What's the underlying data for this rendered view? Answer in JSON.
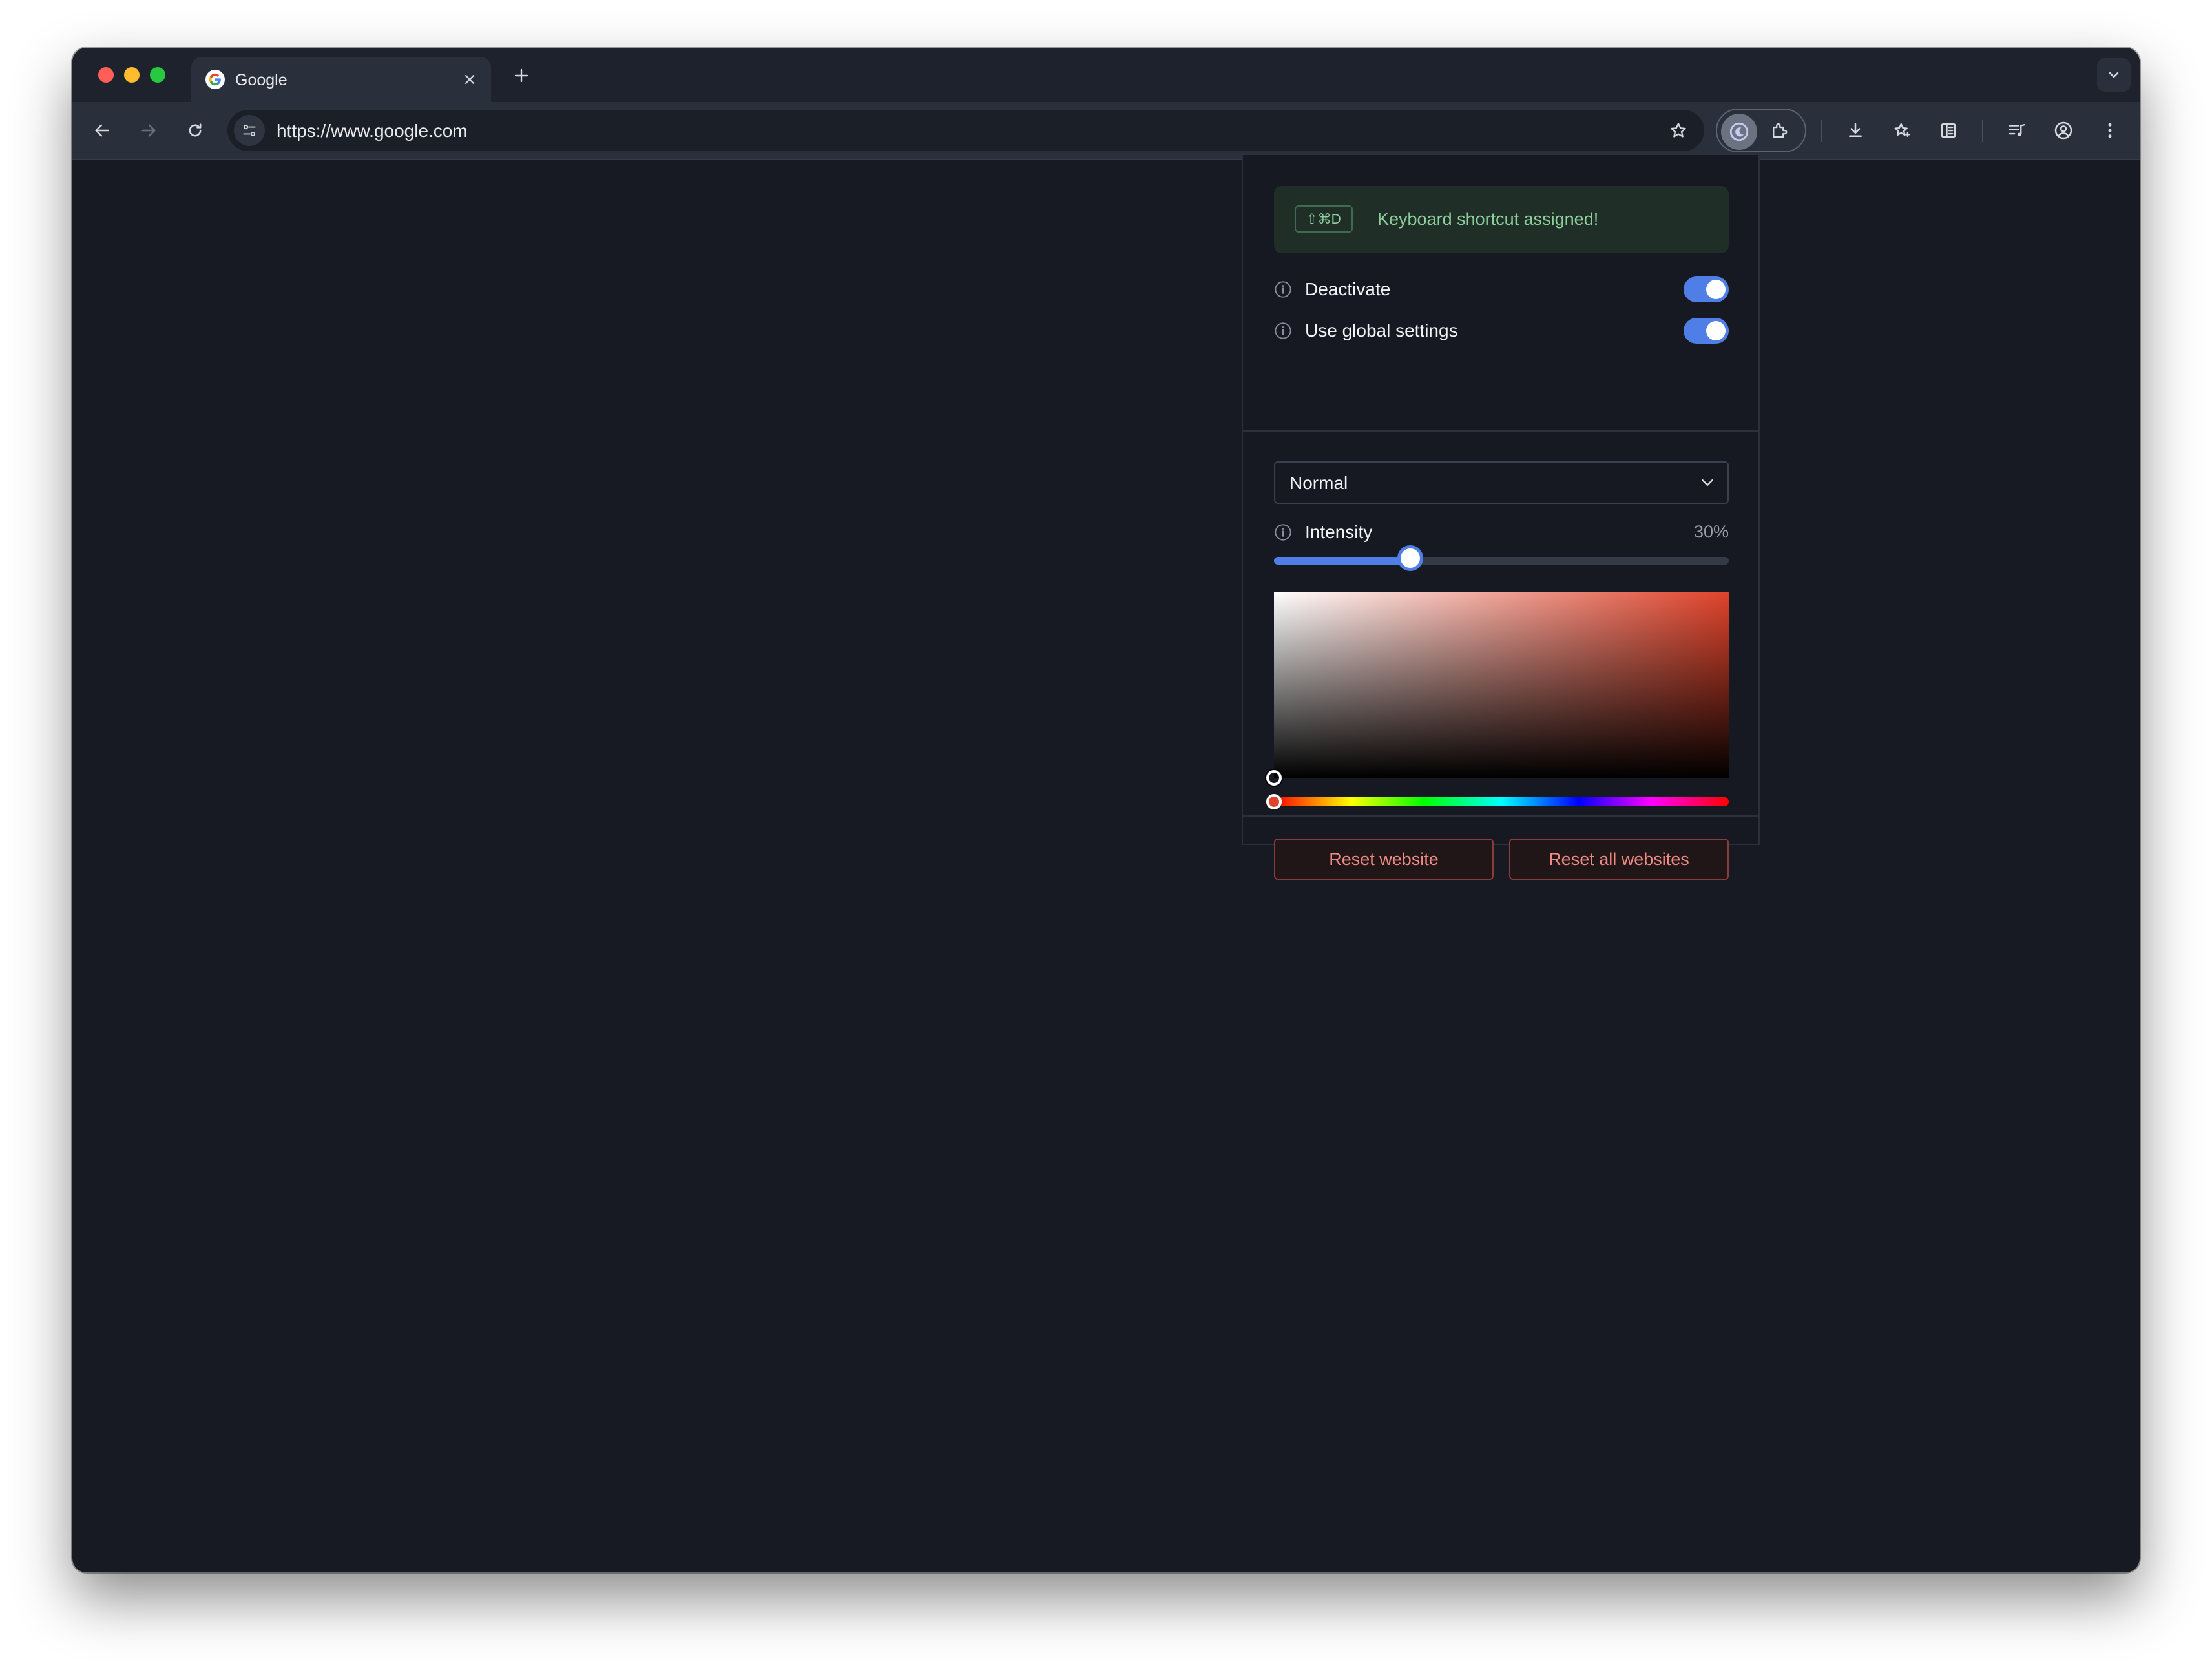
{
  "browser": {
    "tab": {
      "title": "Google",
      "close_icon": "close-icon",
      "favicon": "google-icon"
    },
    "omnibox": {
      "url": "https://www.google.com"
    },
    "toolbar_icons": [
      "back-icon",
      "forward-icon",
      "reload-icon",
      "site-settings-icon",
      "bookmark-star-icon",
      "dark-mode-extension-icon",
      "extensions-puzzle-icon",
      "download-icon",
      "bookmarks-icon",
      "reading-list-icon",
      "media-controls-icon",
      "profile-icon",
      "more-menu-icon"
    ]
  },
  "popup": {
    "banner": {
      "shortcut": "⇧⌘D",
      "message": "Keyboard shortcut assigned!"
    },
    "toggles": [
      {
        "label": "Deactivate",
        "on": true
      },
      {
        "label": "Use global settings",
        "on": true
      }
    ],
    "mode_select": {
      "value": "Normal"
    },
    "intensity": {
      "label": "Intensity",
      "value_text": "30%",
      "fraction": 0.3
    },
    "color": {
      "selected_hue": "#e0432b"
    },
    "buttons": {
      "reset_website": "Reset website",
      "reset_all": "Reset all websites"
    }
  },
  "colors": {
    "accent": "#4f7fe6",
    "danger_text": "#f08a84",
    "success_text": "#8fcf9e"
  }
}
